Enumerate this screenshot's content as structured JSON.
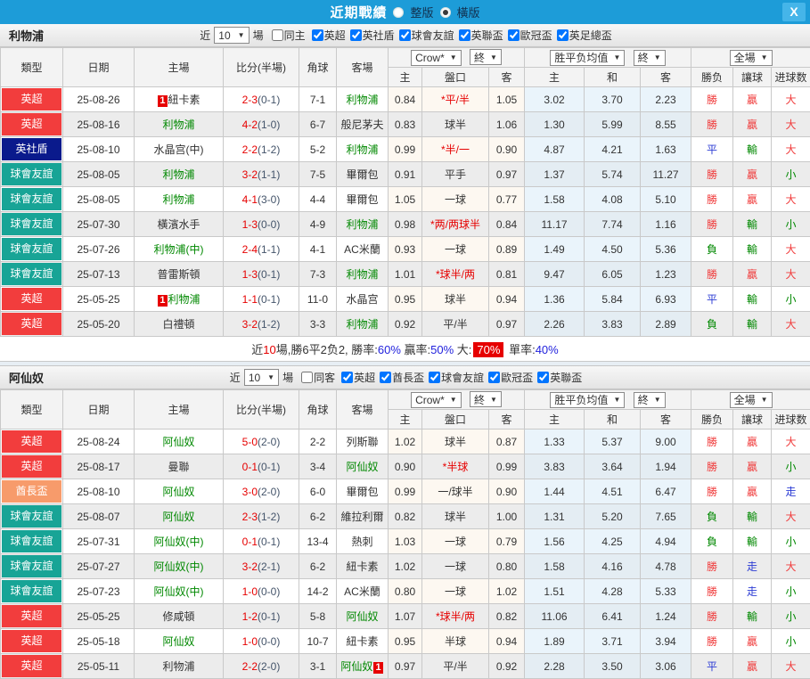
{
  "dialog": {
    "title": "近期戰績",
    "view_options": [
      {
        "label": "整版",
        "selected": false
      },
      {
        "label": "橫版",
        "selected": true
      }
    ],
    "close": "X"
  },
  "filters_common": {
    "near": "近",
    "games": "場",
    "dropdown_arrow": "▼"
  },
  "table_header": {
    "type": "類型",
    "date": "日期",
    "home": "主場",
    "score": "比分(半場)",
    "corners": "角球",
    "away": "客場",
    "odds_select": "Crow*",
    "final_select": "終",
    "avg_select": "胜平负均值",
    "final_select2": "終",
    "full_select": "全場",
    "sub": {
      "home": "主",
      "handicap": "盤口",
      "away": "客",
      "avg_home": "主",
      "avg_draw": "和",
      "avg_away": "客",
      "outcome": "勝负",
      "handicap_result": "讓球",
      "goals": "进球数"
    }
  },
  "league_colors": {
    "英超": "#f23d3d",
    "英社盾": "#0a1a8c",
    "球會友誼": "#18a496",
    "酋長盃": "#f79b6b"
  },
  "result_colors": {
    "red": "res-red",
    "green": "res-green",
    "blue": "res-blue"
  },
  "sections": [
    {
      "team": "利物浦",
      "near_value": "10",
      "same_label": "同主",
      "same_checked": false,
      "leagues": [
        {
          "label": "英超",
          "checked": true
        },
        {
          "label": "英社盾",
          "checked": true
        },
        {
          "label": "球會友誼",
          "checked": true
        },
        {
          "label": "英聯盃",
          "checked": true
        },
        {
          "label": "歐冠盃",
          "checked": true
        },
        {
          "label": "英足總盃",
          "checked": true
        }
      ],
      "rows": [
        {
          "league": "英超",
          "date": "25-08-26",
          "home": {
            "name": "紐卡素",
            "tracked": false,
            "rank": "1",
            "rank_side": "before"
          },
          "ft": "2-3",
          "ht": "(0-1)",
          "corners": "7-1",
          "away": {
            "name": "利物浦",
            "tracked": true
          },
          "oh": "0.84",
          "hc": "*平/半",
          "oa": "1.05",
          "avg": [
            "3.02",
            "3.70",
            "2.23"
          ],
          "res": [
            [
              "勝",
              "red"
            ],
            [
              "贏",
              "red"
            ],
            [
              "大",
              "red"
            ]
          ]
        },
        {
          "league": "英超",
          "date": "25-08-16",
          "home": {
            "name": "利物浦",
            "tracked": true
          },
          "ft": "4-2",
          "ht": "(1-0)",
          "corners": "6-7",
          "away": {
            "name": "般尼茅夫",
            "tracked": false
          },
          "oh": "0.83",
          "hc": "球半",
          "oa": "1.06",
          "avg": [
            "1.30",
            "5.99",
            "8.55"
          ],
          "res": [
            [
              "勝",
              "red"
            ],
            [
              "贏",
              "red"
            ],
            [
              "大",
              "red"
            ]
          ]
        },
        {
          "league": "英社盾",
          "date": "25-08-10",
          "home": {
            "name": "水晶宫(中)",
            "tracked": false
          },
          "ft": "2-2",
          "ht": "(1-2)",
          "corners": "5-2",
          "away": {
            "name": "利物浦",
            "tracked": true
          },
          "oh": "0.99",
          "hc": "*半/一",
          "oa": "0.90",
          "avg": [
            "4.87",
            "4.21",
            "1.63"
          ],
          "res": [
            [
              "平",
              "blue"
            ],
            [
              "輸",
              "green"
            ],
            [
              "大",
              "red"
            ]
          ]
        },
        {
          "league": "球會友誼",
          "date": "25-08-05",
          "home": {
            "name": "利物浦",
            "tracked": true
          },
          "ft": "3-2",
          "ht": "(1-1)",
          "corners": "7-5",
          "away": {
            "name": "畢爾包",
            "tracked": false
          },
          "oh": "0.91",
          "hc": "平手",
          "oa": "0.97",
          "avg": [
            "1.37",
            "5.74",
            "11.27"
          ],
          "res": [
            [
              "勝",
              "red"
            ],
            [
              "贏",
              "red"
            ],
            [
              "小",
              "green"
            ]
          ]
        },
        {
          "league": "球會友誼",
          "date": "25-08-05",
          "home": {
            "name": "利物浦",
            "tracked": true
          },
          "ft": "4-1",
          "ht": "(3-0)",
          "corners": "4-4",
          "away": {
            "name": "畢爾包",
            "tracked": false
          },
          "oh": "1.05",
          "hc": "一球",
          "oa": "0.77",
          "avg": [
            "1.58",
            "4.08",
            "5.10"
          ],
          "res": [
            [
              "勝",
              "red"
            ],
            [
              "贏",
              "red"
            ],
            [
              "大",
              "red"
            ]
          ]
        },
        {
          "league": "球會友誼",
          "date": "25-07-30",
          "home": {
            "name": "橫濱水手",
            "tracked": false
          },
          "ft": "1-3",
          "ht": "(0-0)",
          "corners": "4-9",
          "away": {
            "name": "利物浦",
            "tracked": true
          },
          "oh": "0.98",
          "hc": "*两/两球半",
          "oa": "0.84",
          "avg": [
            "11.17",
            "7.74",
            "1.16"
          ],
          "res": [
            [
              "勝",
              "red"
            ],
            [
              "輸",
              "green"
            ],
            [
              "小",
              "green"
            ]
          ]
        },
        {
          "league": "球會友誼",
          "date": "25-07-26",
          "home": {
            "name": "利物浦(中)",
            "tracked": true
          },
          "ft": "2-4",
          "ht": "(1-1)",
          "corners": "4-1",
          "away": {
            "name": "AC米蘭",
            "tracked": false
          },
          "oh": "0.93",
          "hc": "一球",
          "oa": "0.89",
          "avg": [
            "1.49",
            "4.50",
            "5.36"
          ],
          "res": [
            [
              "負",
              "green"
            ],
            [
              "輸",
              "green"
            ],
            [
              "大",
              "red"
            ]
          ]
        },
        {
          "league": "球會友誼",
          "date": "25-07-13",
          "home": {
            "name": "普雷斯頓",
            "tracked": false
          },
          "ft": "1-3",
          "ht": "(0-1)",
          "corners": "7-3",
          "away": {
            "name": "利物浦",
            "tracked": true
          },
          "oh": "1.01",
          "hc": "*球半/两",
          "oa": "0.81",
          "avg": [
            "9.47",
            "6.05",
            "1.23"
          ],
          "res": [
            [
              "勝",
              "red"
            ],
            [
              "贏",
              "red"
            ],
            [
              "大",
              "red"
            ]
          ]
        },
        {
          "league": "英超",
          "date": "25-05-25",
          "home": {
            "name": "利物浦",
            "tracked": true,
            "rank": "1",
            "rank_side": "before"
          },
          "ft": "1-1",
          "ht": "(0-1)",
          "corners": "11-0",
          "away": {
            "name": "水晶宫",
            "tracked": false
          },
          "oh": "0.95",
          "hc": "球半",
          "oa": "0.94",
          "avg": [
            "1.36",
            "5.84",
            "6.93"
          ],
          "res": [
            [
              "平",
              "blue"
            ],
            [
              "輸",
              "green"
            ],
            [
              "小",
              "green"
            ]
          ]
        },
        {
          "league": "英超",
          "date": "25-05-20",
          "home": {
            "name": "白禮頓",
            "tracked": false
          },
          "ft": "3-2",
          "ht": "(1-2)",
          "corners": "3-3",
          "away": {
            "name": "利物浦",
            "tracked": true
          },
          "oh": "0.92",
          "hc": "平/半",
          "oa": "0.97",
          "avg": [
            "2.26",
            "3.83",
            "2.89"
          ],
          "res": [
            [
              "負",
              "green"
            ],
            [
              "輸",
              "green"
            ],
            [
              "大",
              "red"
            ]
          ]
        }
      ],
      "summary": [
        {
          "t": "近",
          "s": "p"
        },
        {
          "t": "10",
          "s": "r"
        },
        {
          "t": "場,勝6平2负2, 勝率:",
          "s": "p"
        },
        {
          "t": "60%",
          "s": "b"
        },
        {
          "t": " 贏率:",
          "s": "p"
        },
        {
          "t": "50%",
          "s": "b"
        },
        {
          "t": " 大:",
          "s": "p"
        },
        {
          "t": "70%",
          "s": "rb"
        },
        {
          "t": " 單率:",
          "s": "p"
        },
        {
          "t": "40%",
          "s": "b"
        }
      ]
    },
    {
      "team": "阿仙奴",
      "near_value": "10",
      "same_label": "同客",
      "same_checked": false,
      "leagues": [
        {
          "label": "英超",
          "checked": true
        },
        {
          "label": "酋長盃",
          "checked": true
        },
        {
          "label": "球會友誼",
          "checked": true
        },
        {
          "label": "歐冠盃",
          "checked": true
        },
        {
          "label": "英聯盃",
          "checked": true
        }
      ],
      "rows": [
        {
          "league": "英超",
          "date": "25-08-24",
          "home": {
            "name": "阿仙奴",
            "tracked": true
          },
          "ft": "5-0",
          "ht": "(2-0)",
          "corners": "2-2",
          "away": {
            "name": "列斯聯",
            "tracked": false
          },
          "oh": "1.02",
          "hc": "球半",
          "oa": "0.87",
          "avg": [
            "1.33",
            "5.37",
            "9.00"
          ],
          "res": [
            [
              "勝",
              "red"
            ],
            [
              "贏",
              "red"
            ],
            [
              "大",
              "red"
            ]
          ]
        },
        {
          "league": "英超",
          "date": "25-08-17",
          "home": {
            "name": "曼聯",
            "tracked": false
          },
          "ft": "0-1",
          "ht": "(0-1)",
          "corners": "3-4",
          "away": {
            "name": "阿仙奴",
            "tracked": true
          },
          "oh": "0.90",
          "hc": "*半球",
          "oa": "0.99",
          "avg": [
            "3.83",
            "3.64",
            "1.94"
          ],
          "res": [
            [
              "勝",
              "red"
            ],
            [
              "贏",
              "red"
            ],
            [
              "小",
              "green"
            ]
          ]
        },
        {
          "league": "酋長盃",
          "date": "25-08-10",
          "home": {
            "name": "阿仙奴",
            "tracked": true
          },
          "ft": "3-0",
          "ht": "(2-0)",
          "corners": "6-0",
          "away": {
            "name": "畢爾包",
            "tracked": false
          },
          "oh": "0.99",
          "hc": "一/球半",
          "oa": "0.90",
          "avg": [
            "1.44",
            "4.51",
            "6.47"
          ],
          "res": [
            [
              "勝",
              "red"
            ],
            [
              "贏",
              "red"
            ],
            [
              "走",
              "blue"
            ]
          ]
        },
        {
          "league": "球會友誼",
          "date": "25-08-07",
          "home": {
            "name": "阿仙奴",
            "tracked": true
          },
          "ft": "2-3",
          "ht": "(1-2)",
          "corners": "6-2",
          "away": {
            "name": "維拉利爾",
            "tracked": false
          },
          "oh": "0.82",
          "hc": "球半",
          "oa": "1.00",
          "avg": [
            "1.31",
            "5.20",
            "7.65"
          ],
          "res": [
            [
              "負",
              "green"
            ],
            [
              "輸",
              "green"
            ],
            [
              "大",
              "red"
            ]
          ]
        },
        {
          "league": "球會友誼",
          "date": "25-07-31",
          "home": {
            "name": "阿仙奴(中)",
            "tracked": true
          },
          "ft": "0-1",
          "ht": "(0-1)",
          "corners": "13-4",
          "away": {
            "name": "熱刺",
            "tracked": false
          },
          "oh": "1.03",
          "hc": "一球",
          "oa": "0.79",
          "avg": [
            "1.56",
            "4.25",
            "4.94"
          ],
          "res": [
            [
              "負",
              "green"
            ],
            [
              "輸",
              "green"
            ],
            [
              "小",
              "green"
            ]
          ]
        },
        {
          "league": "球會友誼",
          "date": "25-07-27",
          "home": {
            "name": "阿仙奴(中)",
            "tracked": true
          },
          "ft": "3-2",
          "ht": "(2-1)",
          "corners": "6-2",
          "away": {
            "name": "紐卡素",
            "tracked": false
          },
          "oh": "1.02",
          "hc": "一球",
          "oa": "0.80",
          "avg": [
            "1.58",
            "4.16",
            "4.78"
          ],
          "res": [
            [
              "勝",
              "red"
            ],
            [
              "走",
              "blue"
            ],
            [
              "大",
              "red"
            ]
          ]
        },
        {
          "league": "球會友誼",
          "date": "25-07-23",
          "home": {
            "name": "阿仙奴(中)",
            "tracked": true
          },
          "ft": "1-0",
          "ht": "(0-0)",
          "corners": "14-2",
          "away": {
            "name": "AC米蘭",
            "tracked": false
          },
          "oh": "0.80",
          "hc": "一球",
          "oa": "1.02",
          "avg": [
            "1.51",
            "4.28",
            "5.33"
          ],
          "res": [
            [
              "勝",
              "red"
            ],
            [
              "走",
              "blue"
            ],
            [
              "小",
              "green"
            ]
          ]
        },
        {
          "league": "英超",
          "date": "25-05-25",
          "home": {
            "name": "修咸頓",
            "tracked": false
          },
          "ft": "1-2",
          "ht": "(0-1)",
          "corners": "5-8",
          "away": {
            "name": "阿仙奴",
            "tracked": true
          },
          "oh": "1.07",
          "hc": "*球半/两",
          "oa": "0.82",
          "avg": [
            "11.06",
            "6.41",
            "1.24"
          ],
          "res": [
            [
              "勝",
              "red"
            ],
            [
              "輸",
              "green"
            ],
            [
              "小",
              "green"
            ]
          ]
        },
        {
          "league": "英超",
          "date": "25-05-18",
          "home": {
            "name": "阿仙奴",
            "tracked": true
          },
          "ft": "1-0",
          "ht": "(0-0)",
          "corners": "10-7",
          "away": {
            "name": "紐卡素",
            "tracked": false
          },
          "oh": "0.95",
          "hc": "半球",
          "oa": "0.94",
          "avg": [
            "1.89",
            "3.71",
            "3.94"
          ],
          "res": [
            [
              "勝",
              "red"
            ],
            [
              "贏",
              "red"
            ],
            [
              "小",
              "green"
            ]
          ]
        },
        {
          "league": "英超",
          "date": "25-05-11",
          "home": {
            "name": "利物浦",
            "tracked": false
          },
          "ft": "2-2",
          "ht": "(2-0)",
          "corners": "3-1",
          "away": {
            "name": "阿仙奴",
            "tracked": true,
            "rank": "1",
            "rank_side": "after"
          },
          "oh": "0.97",
          "hc": "平/半",
          "oa": "0.92",
          "avg": [
            "2.28",
            "3.50",
            "3.06"
          ],
          "res": [
            [
              "平",
              "blue"
            ],
            [
              "贏",
              "red"
            ],
            [
              "大",
              "red"
            ]
          ]
        }
      ],
      "summary": null
    }
  ]
}
